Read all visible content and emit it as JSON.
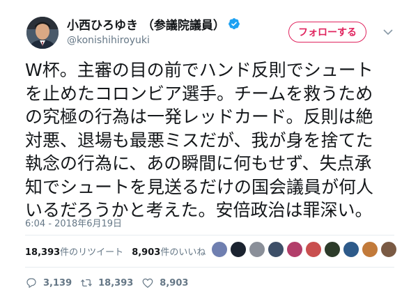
{
  "author": {
    "display_name": "小西ひろゆき （参議院議員）",
    "handle": "@konishihiroyuki",
    "verified": true,
    "avatar_icon": "politician-portrait-icon"
  },
  "follow_button": {
    "label": "フォローする",
    "color": "#e0245e"
  },
  "more_menu_icon": "chevron-down-icon",
  "tweet": {
    "lines": [
      "W杯。主審の目の前でハンド反則でシュート",
      "を止めたコロンビア選手。チームを救うため",
      "の究極の行為は一発レッドカード。反則は絶",
      "対悪、退場も最悪ミスだが、我が身を捨てた",
      "執念の行為に、あの瞬間に何もせず、失点承",
      "知でシュートを見送るだけの国会議員が何人",
      "いるだろうかと考えた。安倍政治は罪深い。"
    ],
    "timestamp": "6:04 - 2018年6月19日"
  },
  "stats": {
    "retweets_count": "18,393",
    "retweets_label": "件のリツイート",
    "likes_count": "8,903",
    "likes_label": "件のいいね",
    "liker_avatar_colors": [
      "#6f7fb0",
      "#1b2330",
      "#8a8f99",
      "#3d4f68",
      "#b23e6a",
      "#c94f4f",
      "#2c3b2a",
      "#2d5a8a",
      "#c27a3a",
      "#7a5a44"
    ]
  },
  "actions": {
    "reply_count": "3,139",
    "retweet_count": "18,393",
    "like_count": "8,903"
  },
  "colors": {
    "text": "#14171a",
    "secondary": "#657786",
    "verified_blue": "#1da1f2",
    "divider": "#e6ecf0"
  }
}
